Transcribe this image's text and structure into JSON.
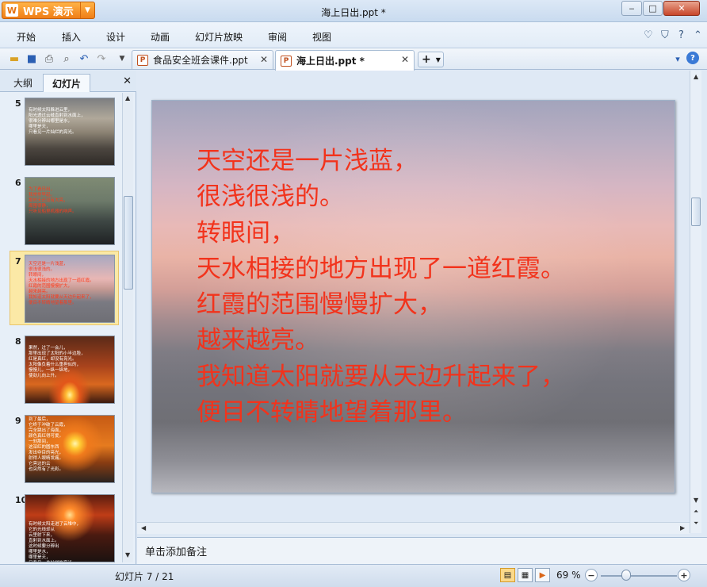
{
  "window": {
    "title": "海上日出.ppt *",
    "app_button": "WPS 演示",
    "controls": {
      "minimize": "‒",
      "maximize": "□",
      "close": "✕"
    }
  },
  "menu": {
    "items": [
      "开始",
      "插入",
      "设计",
      "动画",
      "幻灯片放映",
      "审阅",
      "视图"
    ],
    "right_icons": [
      "heart-icon",
      "shirt-icon",
      "help-icon",
      "chevron-up-icon"
    ]
  },
  "toolbar": {
    "icons": [
      "open-icon",
      "save-icon",
      "print-icon",
      "print-preview-icon",
      "undo-icon",
      "redo-icon",
      "dropdown-icon"
    ]
  },
  "doc_tabs": [
    {
      "label": "食品安全班会课件.ppt",
      "active": false
    },
    {
      "label": "海上日出.ppt *",
      "active": true
    }
  ],
  "left_panel": {
    "tabs": [
      "大纲",
      "幻灯片"
    ],
    "active_tab": "幻灯片",
    "close": "✕",
    "thumbnails": [
      {
        "number": "5",
        "text": "有时候太阳躲进云里，\n阳光透过云缝直射到水面上，\n很难分辨出哪里是水，\n哪里是天，\n只看见一片灿烂的亮光。",
        "text_color": "#ffffff"
      },
      {
        "number": "6",
        "text": "为了看日出，\n我常常早起。\n那时天还没有大亮，\n周围很静，\n只听见船里机器的响声。",
        "text_color": "#ff3a1a"
      },
      {
        "number": "7",
        "text": "天空还是一片浅蓝，\n很浅很浅的。\n转眼间，\n天水相接的地方出现了一道红霞。\n红霞的范围慢慢扩大，\n越来越亮。\n我知道太阳就要从天边升起来了，\n便目不转睛地望着那里。",
        "text_color": "#ff3a1a",
        "selected": true
      },
      {
        "number": "8",
        "text": "果然，过了一会儿，\n那里出现了太阳的小半边脸，\n红是真红，却没有亮光。\n太阳像负着什么重担似的，\n慢慢儿，一纵一纵地，\n使劲儿向上升。",
        "text_color": "#ffffff"
      },
      {
        "number": "9",
        "text": "到了最后，\n它终于冲破了云霞，\n完全跳出了海面，\n颜色真红得可爱。\n一刹那间，\n这深红的圆东西\n发出夺目的亮光，\n射得人眼睛发痛。\n它旁边的云\n也突然有了光彩。",
        "text_color": "#ffffff"
      },
      {
        "number": "10",
        "text": "有时候太阳走进了云堆中，\n它的光线却从\n云里射下来，\n直射到水面上。\n这时候要分辨出\n哪里是水，\n哪里是天，\n只看见一片灿烂的亮光。",
        "text_color": "#ffffff"
      }
    ]
  },
  "slide": {
    "lines": [
      "天空还是一片浅蓝，",
      "很浅很浅的。",
      "转眼间，",
      "天水相接的地方出现了一道红霞。",
      "红霞的范围慢慢扩大，",
      "越来越亮。",
      "我知道太阳就要从天边升起来了，",
      "便目不转睛地望着那里。"
    ],
    "text_color": "#f2331c"
  },
  "notes": {
    "placeholder": "单击添加备注"
  },
  "status": {
    "slide_counter": "幻灯片 7 / 21",
    "zoom": "69 %",
    "zoom_level_percent": 69
  }
}
